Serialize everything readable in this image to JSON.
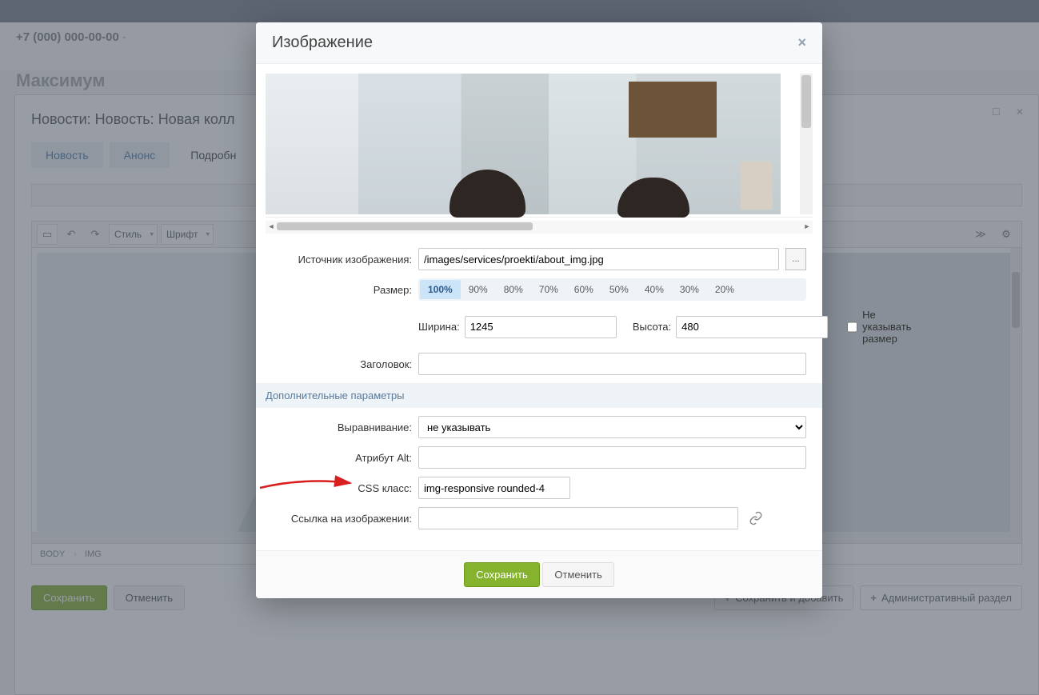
{
  "background": {
    "phone": "+7 (000) 000-00-00",
    "phone_dash": " -",
    "brand": "Максимум",
    "toolbar_user": "",
    "editor_title_prefix": "Новости: Новость: ",
    "editor_title_item": "Новая колл",
    "tabs": {
      "news": "Новость",
      "anons": "Анонс",
      "details": "Подробн"
    },
    "rte": {
      "style": "Стиль",
      "font": "Шрифт"
    },
    "path": {
      "body": "BODY",
      "img": "IMG"
    },
    "actions": {
      "save": "Сохранить",
      "cancel": "Отменить",
      "save_add": "Сохранить и добавить",
      "admin_section": "Административный раздел"
    }
  },
  "modal": {
    "title": "Изображение",
    "source_label": "Источник изображения:",
    "source_value": "/images/services/proekti/about_img.jpg",
    "browse": "...",
    "size_label": "Размер:",
    "sizes": [
      "100%",
      "90%",
      "80%",
      "70%",
      "60%",
      "50%",
      "40%",
      "30%",
      "20%"
    ],
    "size_active": "100%",
    "width_label": "Ширина:",
    "width_value": "1245",
    "height_label": "Высота:",
    "height_value": "480",
    "nosize_label": "Не указывать размер",
    "title_label": "Заголовок:",
    "title_value": "",
    "extra_header": "Дополнительные параметры",
    "align_label": "Выравнивание:",
    "align_value": "не указывать",
    "alt_label": "Атрибут Alt:",
    "alt_value": "",
    "css_label": "CSS класс:",
    "css_value": "img-responsive rounded-4",
    "link_label": "Ссылка на изображении:",
    "link_value": "",
    "save": "Сохранить",
    "cancel": "Отменить"
  }
}
